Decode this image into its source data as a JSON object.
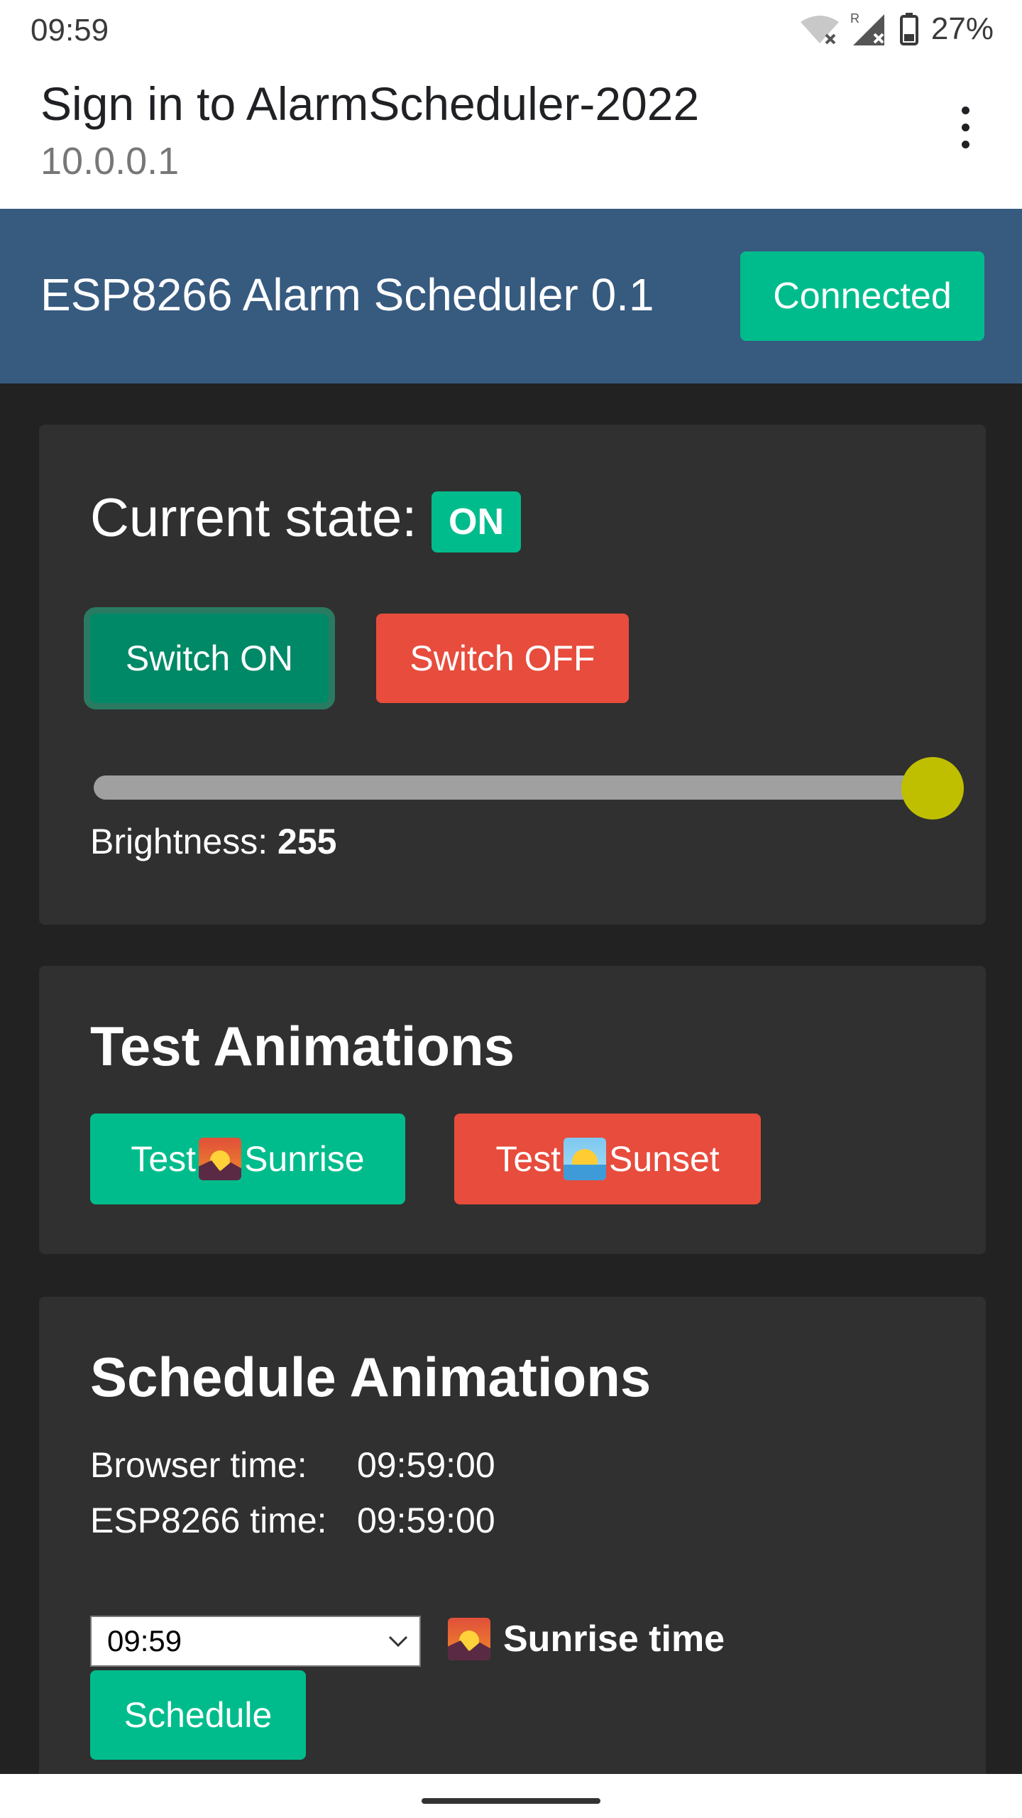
{
  "status_bar": {
    "time": "09:59",
    "battery": "27%"
  },
  "browser": {
    "title": "Sign in to AlarmScheduler-2022",
    "url": "10.0.0.1"
  },
  "navbar": {
    "brand": "ESP8266 Alarm Scheduler 0.1",
    "status_button": "Connected"
  },
  "state_card": {
    "title": "Current state:",
    "badge": "ON",
    "switch_on": "Switch ON",
    "switch_off": "Switch OFF",
    "brightness_label": "Brightness:",
    "brightness_value": "255",
    "brightness_level": 255,
    "brightness_max": 255
  },
  "test_card": {
    "title": "Test Animations",
    "sunrise_prefix": "Test",
    "sunrise_label": "Sunrise",
    "sunset_prefix": "Test",
    "sunset_label": "Sunset"
  },
  "schedule_card": {
    "title": "Schedule Animations",
    "browser_time_label": "Browser time:",
    "browser_time": "09:59:00",
    "esp_time_label": "ESP8266 time:",
    "esp_time": "09:59:00",
    "selected_time": "09:59",
    "sunrise_time_label": "Sunrise time",
    "schedule_button": "Schedule"
  },
  "colors": {
    "success": "#00bc8c",
    "danger": "#e74c3c",
    "navbar": "#375a7f",
    "card": "#303030",
    "background": "#222222"
  }
}
